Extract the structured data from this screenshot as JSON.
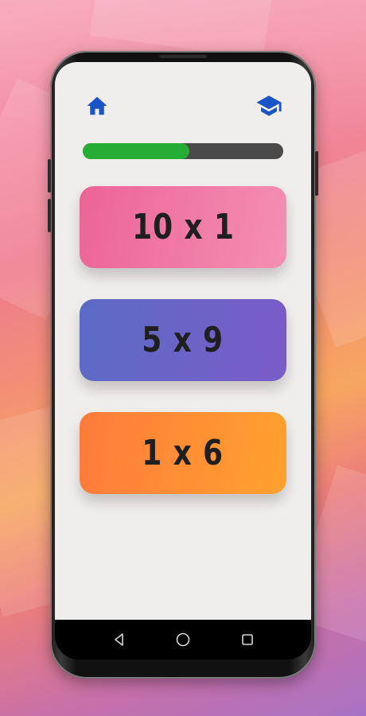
{
  "colors": {
    "accent_blue": "#1a55c8",
    "progress_green": "#25ad35",
    "progress_track": "#4a4a4a",
    "screen_bg": "#f0eded"
  },
  "header": {
    "home_icon": "home-icon",
    "learn_icon": "graduation-cap-icon"
  },
  "progress": {
    "fraction": 0.53
  },
  "answers": [
    {
      "label": "10 x 1",
      "color_start": "#ec6496",
      "color_end": "#f48fb3"
    },
    {
      "label": "5 x 9",
      "color_start": "#5b6cc6",
      "color_end": "#7b5bc8"
    },
    {
      "label": "1 x 6",
      "color_start": "#ff7a3c",
      "color_end": "#ffa22e"
    }
  ],
  "system_nav": {
    "back_icon": "back-triangle-icon",
    "home_icon": "home-circle-icon",
    "recents_icon": "recents-square-icon"
  }
}
